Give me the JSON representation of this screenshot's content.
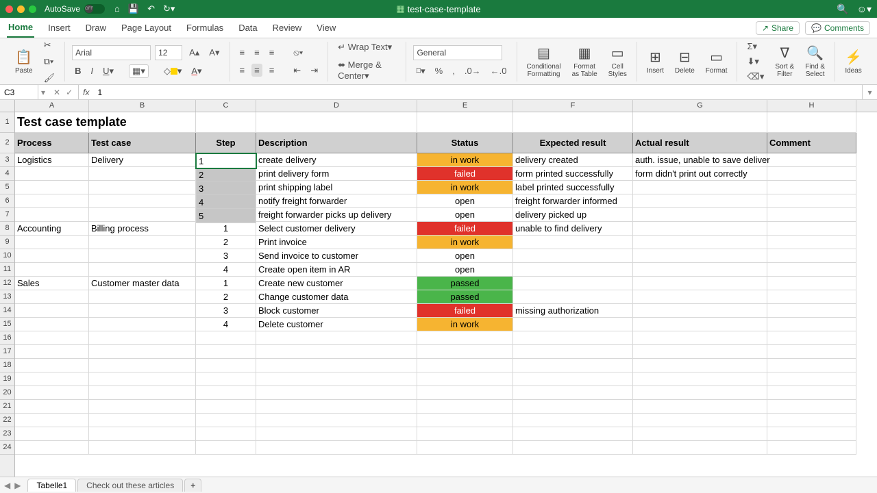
{
  "window": {
    "autosave": "AutoSave",
    "off": "OFF",
    "doc": "test-case-template"
  },
  "tabs": {
    "home": "Home",
    "insert": "Insert",
    "draw": "Draw",
    "page": "Page Layout",
    "formulas": "Formulas",
    "data": "Data",
    "review": "Review",
    "view": "View",
    "share": "Share",
    "comments": "Comments"
  },
  "ribbon": {
    "paste": "Paste",
    "font": "Arial",
    "size": "12",
    "wrap": "Wrap Text",
    "merge": "Merge & Center",
    "numfmt": "General",
    "cond": "Conditional\nFormatting",
    "fat": "Format\nas Table",
    "cstyles": "Cell\nStyles",
    "insert": "Insert",
    "delete": "Delete",
    "format": "Format",
    "sort": "Sort &\nFilter",
    "find": "Find &\nSelect",
    "ideas": "Ideas"
  },
  "fbar": {
    "name": "C3",
    "val": "1"
  },
  "cols": [
    "A",
    "B",
    "C",
    "D",
    "E",
    "F",
    "G",
    "H"
  ],
  "sheet": {
    "title": "Test case template",
    "headers": {
      "process": "Process",
      "testcase": "Test case",
      "step": "Step",
      "desc": "Description",
      "status": "Status",
      "expected": "Expected result",
      "actual": "Actual result",
      "comment": "Comment"
    },
    "rows": [
      {
        "n": 3,
        "A": "Logistics",
        "B": "Delivery",
        "C": "1",
        "D": "create delivery",
        "E": "in work",
        "F": "delivery created",
        "G": "auth. issue, unable to save deliver",
        "status": "inwork",
        "sel": true,
        "active": true
      },
      {
        "n": 4,
        "A": "",
        "B": "",
        "C": "2",
        "D": "print delivery form",
        "E": "failed",
        "F": "form printed successfully",
        "G": "form didn't print out correctly",
        "status": "failed",
        "sel": true
      },
      {
        "n": 5,
        "A": "",
        "B": "",
        "C": "3",
        "D": "print shipping label",
        "E": "in work",
        "F": "label printed successfully",
        "G": "",
        "status": "inwork",
        "sel": true
      },
      {
        "n": 6,
        "A": "",
        "B": "",
        "C": "4",
        "D": "notify freight forwarder",
        "E": "open",
        "F": "freight forwarder informed",
        "G": "",
        "status": "open",
        "sel": true
      },
      {
        "n": 7,
        "A": "",
        "B": "",
        "C": "5",
        "D": "freight forwarder picks up delivery",
        "E": "open",
        "F": "delivery picked up",
        "G": "",
        "status": "open",
        "sel": true
      },
      {
        "n": 8,
        "A": "Accounting",
        "B": "Billing process",
        "C": "1",
        "D": "Select customer delivery",
        "E": "failed",
        "F": "unable to find delivery",
        "G": "",
        "status": "failed"
      },
      {
        "n": 9,
        "A": "",
        "B": "",
        "C": "2",
        "D": "Print invoice",
        "E": "in work",
        "F": "",
        "G": "",
        "status": "inwork"
      },
      {
        "n": 10,
        "A": "",
        "B": "",
        "C": "3",
        "D": "Send invoice to customer",
        "E": "open",
        "F": "",
        "G": "",
        "status": "open"
      },
      {
        "n": 11,
        "A": "",
        "B": "",
        "C": "4",
        "D": "Create open item in AR",
        "E": "open",
        "F": "",
        "G": "",
        "status": "open"
      },
      {
        "n": 12,
        "A": "Sales",
        "B": "Customer master data",
        "C": "1",
        "D": "Create new customer",
        "E": "passed",
        "F": "",
        "G": "",
        "status": "passed"
      },
      {
        "n": 13,
        "A": "",
        "B": "",
        "C": "2",
        "D": "Change customer data",
        "E": "passed",
        "F": "",
        "G": "",
        "status": "passed"
      },
      {
        "n": 14,
        "A": "",
        "B": "",
        "C": "3",
        "D": "Block customer",
        "E": "failed",
        "F": "missing authorization",
        "G": "",
        "status": "failed"
      },
      {
        "n": 15,
        "A": "",
        "B": "",
        "C": "4",
        "D": "Delete customer",
        "E": "in work",
        "F": "",
        "G": "",
        "status": "inwork"
      }
    ],
    "blanks": [
      16,
      17,
      18,
      19,
      20,
      21,
      22,
      23,
      24
    ]
  },
  "sheets": {
    "active": "Tabelle1",
    "other": "Check out these articles",
    "add": "+"
  }
}
